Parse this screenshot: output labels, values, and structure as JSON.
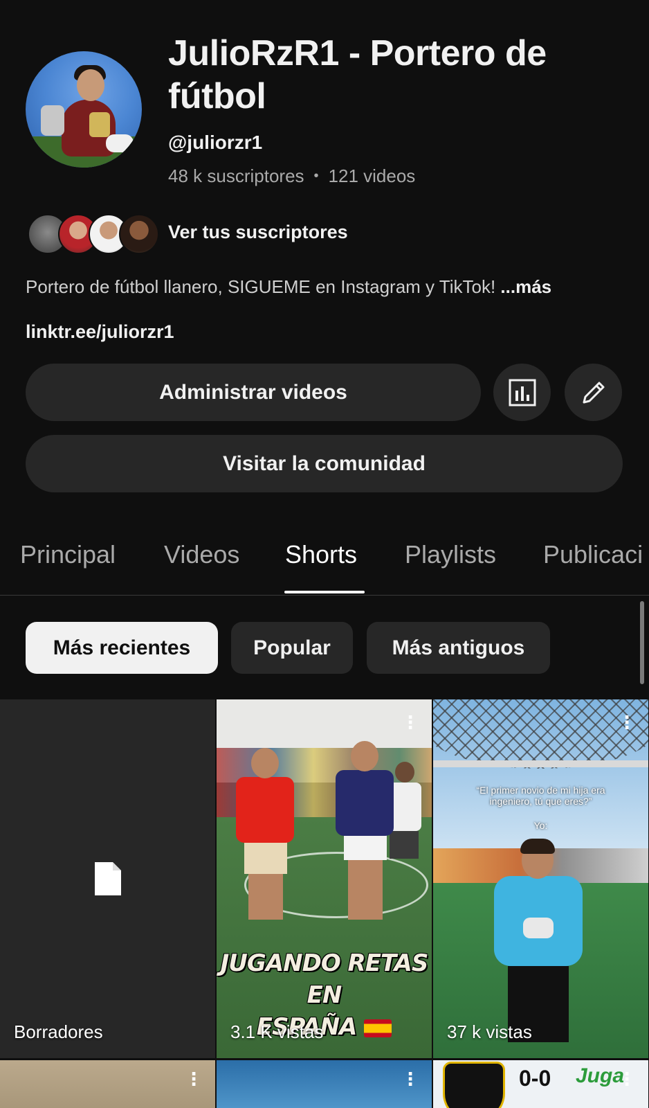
{
  "channel": {
    "title": "JulioRzR1 - Portero de fútbol",
    "handle": "@juliorzr1",
    "subscribers": "48 k suscriptores",
    "separator": "•",
    "videos": "121 videos",
    "see_subscribers": "Ver tus suscriptores",
    "description": "Portero de fútbol llanero, SIGUEME en Instagram y TikTok!",
    "more": "...más",
    "link": "linktr.ee/juliorzr1"
  },
  "actions": {
    "manage_videos": "Administrar videos",
    "analytics_icon": "analytics-icon",
    "edit_icon": "pencil-icon",
    "visit_community": "Visitar la comunidad"
  },
  "tabs": [
    {
      "label": "Principal",
      "active": false
    },
    {
      "label": "Videos",
      "active": false
    },
    {
      "label": "Shorts",
      "active": true
    },
    {
      "label": "Playlists",
      "active": false
    },
    {
      "label": "Publicaci",
      "active": false
    }
  ],
  "filters": [
    {
      "label": "Más recientes",
      "selected": true
    },
    {
      "label": "Popular",
      "selected": false
    },
    {
      "label": "Más antiguos",
      "selected": false
    }
  ],
  "shorts": [
    {
      "label": "Borradores",
      "icon": "document-icon"
    },
    {
      "views": "3.1 K vistas",
      "caption_line1": "JUGANDO RETAS EN",
      "caption_line2": "ESPAÑA"
    },
    {
      "views": "37 k vistas",
      "overlay_text": "“El primer novio de mi hija era ingeniero, tú que eres?”",
      "overlay_text2": "Yo:"
    }
  ],
  "partial_row": [
    {
      "score": null
    },
    {
      "score": null
    },
    {
      "score": "0-0",
      "logo_text": "Juga"
    }
  ],
  "colors": {
    "background": "#0f0f0f",
    "surface": "#272727",
    "text_primary": "#f1f1f1",
    "text_secondary": "#aaaaaa"
  }
}
